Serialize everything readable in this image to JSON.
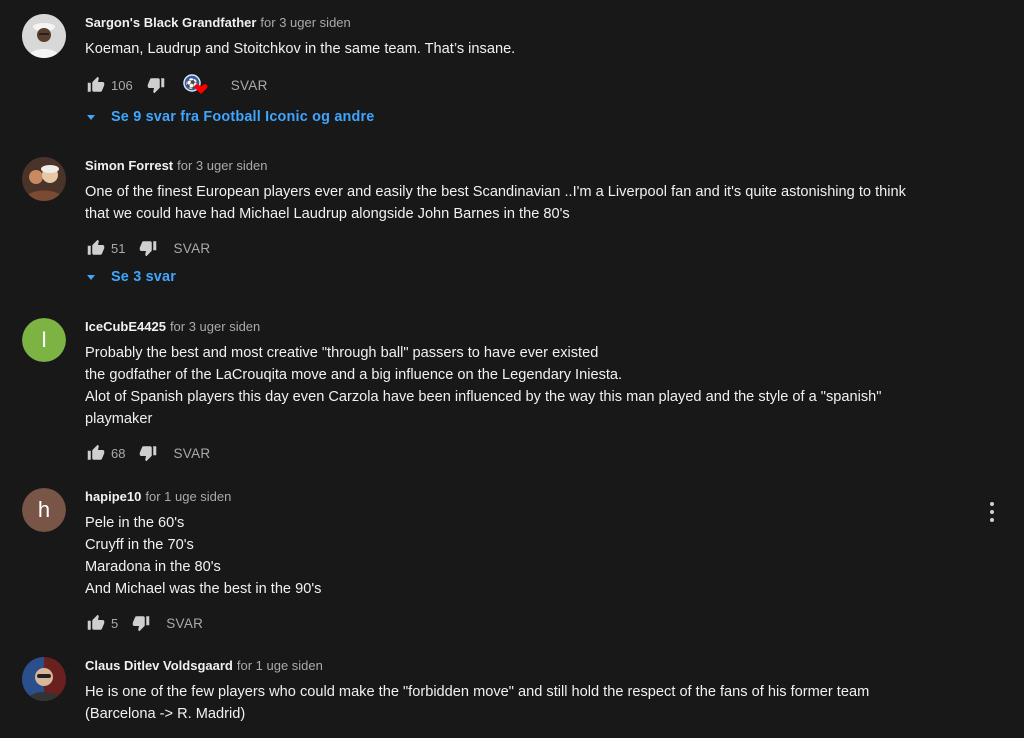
{
  "comments": [
    {
      "author": "Sargon's Black Grandfather",
      "time": "for 3 uger siden",
      "lines": [
        "Koeman, Laudrup and Stoitchkov in the same team. That’s insane."
      ],
      "likes": "106",
      "reply_label": "SVAR",
      "replies_label": "Se 9 svar fra Football Iconic og andre",
      "hearted": true
    },
    {
      "author": "Simon Forrest",
      "time": "for 3 uger siden",
      "lines": [
        "One of the finest European players ever and easily the best Scandinavian ..I'm a Liverpool fan and it's quite astonishing to think",
        "that we could have had Michael Laudrup alongside John Barnes in the 80's"
      ],
      "likes": "51",
      "reply_label": "SVAR",
      "replies_label": "Se 3 svar"
    },
    {
      "author": "IceCubE4425",
      "time": "for 3 uger siden",
      "avatar_letter": "I",
      "avatar_color": "#7cb342",
      "lines": [
        "Probably the best and most creative \"through ball\" passers to have ever existed",
        "the godfather of the LaCrouqita move and a big influence on the Legendary Iniesta.",
        "Alot of Spanish players this day even Carzola have been influenced by the way this man played and the style of a \"spanish\"",
        "playmaker"
      ],
      "likes": "68",
      "reply_label": "SVAR"
    },
    {
      "author": "hapipe10",
      "time": "for 1 uge siden",
      "avatar_letter": "h",
      "avatar_color": "#795548",
      "lines": [
        "Pele in the 60's",
        "Cruyff in the 70's",
        "Maradona in the 80's",
        "And Michael was the best in the 90's"
      ],
      "likes": "5",
      "reply_label": "SVAR"
    },
    {
      "author": "Claus Ditlev Voldsgaard",
      "time": "for 1 uge siden",
      "lines": [
        "He is one of the few players who could make the \"forbidden move\" and still hold the respect of the fans of his former team",
        "(Barcelona -> R. Madrid)"
      ]
    }
  ],
  "icons": {
    "like": "thumbs-up-icon",
    "dislike": "thumbs-down-icon",
    "heart": "creator-heart-icon",
    "caret": "caret-down-icon",
    "menu": "more-vert-icon"
  },
  "colors": {
    "background": "#181818",
    "link": "#3ea6ff",
    "muted": "#aaaaaa",
    "text": "#f1f1f1",
    "heart": "#ff0000"
  }
}
